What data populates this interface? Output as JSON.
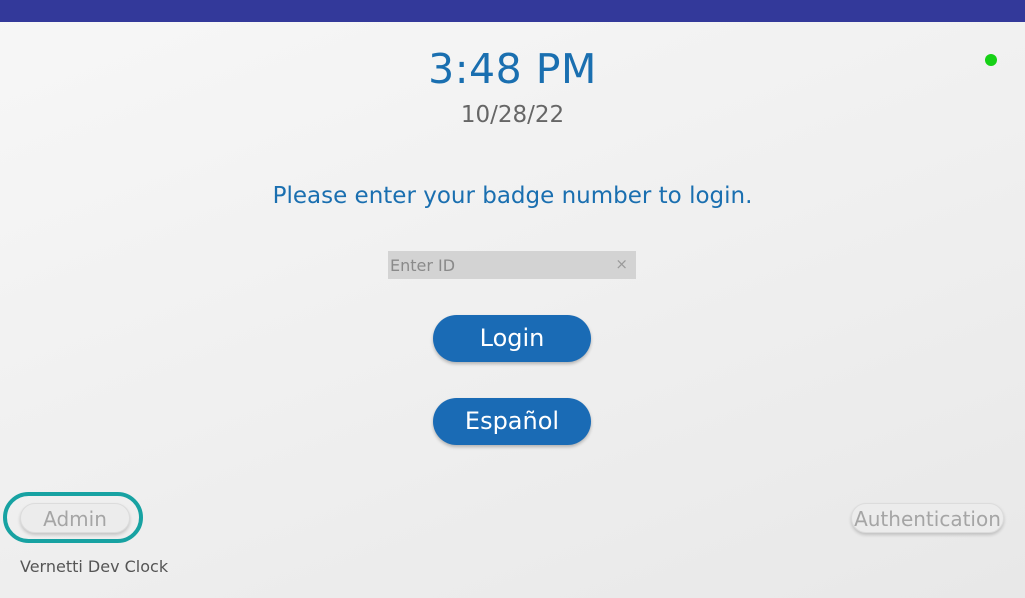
{
  "header": {
    "bar_color": "#33399a",
    "status_indicator": {
      "state": "online",
      "color": "#16d116"
    }
  },
  "clock": {
    "time": "3:48 PM",
    "date": "10/28/22"
  },
  "prompt": "Please enter your badge number to login.",
  "badge_input": {
    "value": "",
    "placeholder": "Enter ID",
    "clear_icon": "×"
  },
  "buttons": {
    "login": "Login",
    "spanish": "Español",
    "admin": "Admin",
    "authentication": "Authentication"
  },
  "footer": {
    "device_name": "Vernetti Dev Clock"
  },
  "colors": {
    "accent": "#1a6fb0",
    "button": "#1a6bb5",
    "highlight": "#17a2a2"
  }
}
